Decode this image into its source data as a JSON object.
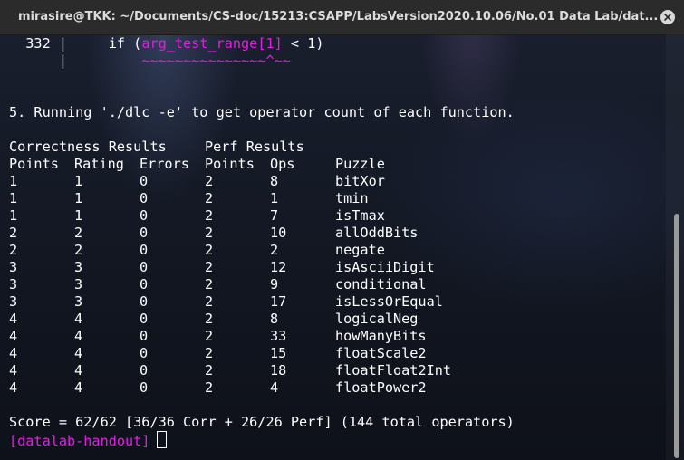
{
  "window": {
    "title": "mirasire@TKK: ~/Documents/CS-doc/15213:CSAPP/LabsVersion2020.10.06/No.01 Data Lab/dat..."
  },
  "terminal": {
    "code_line1_prefix": "  332 |     if (",
    "code_line1_highlight": "arg_test_range[1]",
    "code_line1_suffix": " < 1)",
    "code_line2_prefix": "      |         ",
    "code_line2_squiggle": "~~~~~~~~~~~~~~~^~~",
    "step_text": "5. Running './dlc -e' to get operator count of each function.",
    "results_header": {
      "correctness": "Correctness Results",
      "perf": "Perf Results"
    },
    "columns": [
      "Points",
      "Rating",
      "Errors",
      "Points",
      "Ops",
      "Puzzle"
    ],
    "rows": [
      [
        "1",
        "1",
        "0",
        "2",
        "8",
        "bitXor"
      ],
      [
        "1",
        "1",
        "0",
        "2",
        "1",
        "tmin"
      ],
      [
        "1",
        "1",
        "0",
        "2",
        "7",
        "isTmax"
      ],
      [
        "2",
        "2",
        "0",
        "2",
        "10",
        "allOddBits"
      ],
      [
        "2",
        "2",
        "0",
        "2",
        "2",
        "negate"
      ],
      [
        "3",
        "3",
        "0",
        "2",
        "12",
        "isAsciiDigit"
      ],
      [
        "3",
        "3",
        "0",
        "2",
        "9",
        "conditional"
      ],
      [
        "3",
        "3",
        "0",
        "2",
        "17",
        "isLessOrEqual"
      ],
      [
        "4",
        "4",
        "0",
        "2",
        "8",
        "logicalNeg"
      ],
      [
        "4",
        "4",
        "0",
        "2",
        "33",
        "howManyBits"
      ],
      [
        "4",
        "4",
        "0",
        "2",
        "15",
        "floatScale2"
      ],
      [
        "4",
        "4",
        "0",
        "2",
        "18",
        "floatFloat2Int"
      ],
      [
        "4",
        "4",
        "0",
        "2",
        "4",
        "floatPower2"
      ]
    ],
    "score_line": "Score = 62/62 [36/36 Corr + 26/26 Perf] (144 total operators)",
    "prompt": "[datalab-handout]"
  },
  "colors": {
    "highlight": "#e020e0",
    "text": "#ffffff",
    "titlebar": "#2b2b2b"
  },
  "icons": {
    "close": "close-icon"
  }
}
